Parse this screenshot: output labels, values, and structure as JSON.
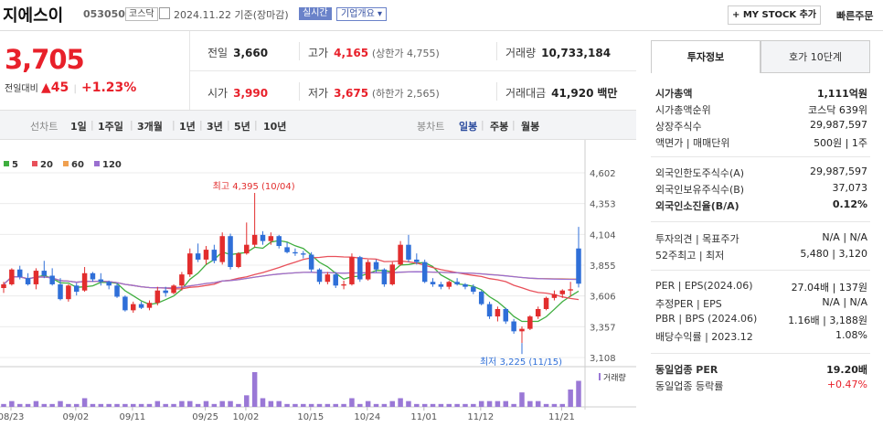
{
  "header": {
    "name": "지에스이",
    "code": "053050",
    "market": "코스닥",
    "date": "2024.11.22 기준(장마감)",
    "realtime_label": "실시간",
    "company_label": "기업개요",
    "mystock_label": "+ MY STOCK 추가",
    "quick_order": "빠른주문"
  },
  "price": {
    "current": "3,705",
    "change_label": "전일대비",
    "change_value": "▲45",
    "change_pct": "+1.23%"
  },
  "stats": {
    "prev_label": "전일",
    "prev": "3,660",
    "high_label": "고가",
    "high": "4,165",
    "high_sub": "(상한가 4,755)",
    "volume_label": "거래량",
    "volume": "10,733,184",
    "open_label": "시가",
    "open": "3,990",
    "low_label": "저가",
    "low": "3,675",
    "low_sub": "(하한가 2,565)",
    "amount_label": "거래대금",
    "amount": "41,920",
    "amount_unit": "백만"
  },
  "tabs": {
    "line_label": "선차트",
    "ranges": [
      "1일",
      "1주일",
      "3개월",
      "1년",
      "3년",
      "5년",
      "10년"
    ],
    "candle_label": "봉차트",
    "periods": [
      "일봉",
      "주봉",
      "월봉"
    ]
  },
  "chart_data": {
    "type": "candlestick",
    "legend": [
      {
        "name": "5",
        "color": "#3fae3f"
      },
      {
        "name": "20",
        "color": "#e8505a"
      },
      {
        "name": "60",
        "color": "#f0a050"
      },
      {
        "name": "120",
        "color": "#9a6fd0"
      }
    ],
    "y_ticks": [
      "4,602",
      "4,353",
      "4,104",
      "3,855",
      "3,606",
      "3,357",
      "3,108"
    ],
    "ylim": [
      3108,
      4602
    ],
    "x_ticks": [
      "08/23",
      "09/02",
      "09/11",
      "09/25",
      "10/02",
      "10/15",
      "10/24",
      "11/01",
      "11/12",
      "11/21"
    ],
    "annotation_high": "최고 4,395 (10/04)",
    "annotation_low": "최저 3,225 (11/15)",
    "volume_label": "거래량",
    "candles": [
      [
        3670,
        3720,
        3630,
        3700
      ],
      [
        3700,
        3830,
        3690,
        3820
      ],
      [
        3820,
        3850,
        3740,
        3760
      ],
      [
        3750,
        3790,
        3690,
        3700
      ],
      [
        3700,
        3830,
        3660,
        3810
      ],
      [
        3810,
        3890,
        3750,
        3770
      ],
      [
        3770,
        3830,
        3690,
        3700
      ],
      [
        3700,
        3750,
        3570,
        3580
      ],
      [
        3580,
        3700,
        3560,
        3690
      ],
      [
        3690,
        3710,
        3610,
        3640
      ],
      [
        3650,
        3840,
        3640,
        3790
      ],
      [
        3790,
        3800,
        3720,
        3740
      ],
      [
        3740,
        3790,
        3690,
        3720
      ],
      [
        3720,
        3730,
        3660,
        3690
      ],
      [
        3690,
        3710,
        3590,
        3600
      ],
      [
        3600,
        3610,
        3480,
        3490
      ],
      [
        3490,
        3560,
        3470,
        3540
      ],
      [
        3540,
        3560,
        3500,
        3510
      ],
      [
        3510,
        3570,
        3490,
        3550
      ],
      [
        3550,
        3680,
        3530,
        3650
      ],
      [
        3650,
        3680,
        3600,
        3630
      ],
      [
        3630,
        3700,
        3620,
        3690
      ],
      [
        3690,
        3800,
        3650,
        3780
      ],
      [
        3780,
        3990,
        3760,
        3950
      ],
      [
        3950,
        4030,
        3880,
        3900
      ],
      [
        3900,
        4010,
        3860,
        3980
      ],
      [
        3980,
        4020,
        3870,
        3890
      ],
      [
        3880,
        4120,
        3860,
        4090
      ],
      [
        4090,
        4110,
        3820,
        3840
      ],
      [
        3840,
        3960,
        3830,
        3950
      ],
      [
        3950,
        4200,
        3940,
        4020
      ],
      [
        4020,
        4395,
        4000,
        4100
      ],
      [
        4100,
        4130,
        4020,
        4050
      ],
      [
        4050,
        4120,
        4020,
        4090
      ],
      [
        4090,
        4100,
        3990,
        4010
      ],
      [
        4000,
        4040,
        3950,
        3960
      ],
      [
        3960,
        3990,
        3930,
        3950
      ],
      [
        3950,
        3970,
        3910,
        3940
      ],
      [
        3940,
        3960,
        3800,
        3820
      ],
      [
        3820,
        3830,
        3700,
        3720
      ],
      [
        3720,
        3800,
        3700,
        3780
      ],
      [
        3780,
        3800,
        3670,
        3690
      ],
      [
        3690,
        3730,
        3660,
        3700
      ],
      [
        3700,
        3950,
        3690,
        3920
      ],
      [
        3920,
        3930,
        3720,
        3740
      ],
      [
        3740,
        3900,
        3730,
        3880
      ],
      [
        3880,
        3900,
        3800,
        3820
      ],
      [
        3820,
        3830,
        3680,
        3700
      ],
      [
        3700,
        3880,
        3690,
        3860
      ],
      [
        3860,
        4050,
        3850,
        4020
      ],
      [
        4020,
        4100,
        3880,
        3900
      ],
      [
        3900,
        3950,
        3860,
        3880
      ],
      [
        3880,
        3900,
        3710,
        3720
      ],
      [
        3720,
        3750,
        3680,
        3700
      ],
      [
        3700,
        3720,
        3660,
        3680
      ],
      [
        3680,
        3730,
        3660,
        3720
      ],
      [
        3720,
        3750,
        3690,
        3700
      ],
      [
        3700,
        3710,
        3660,
        3680
      ],
      [
        3680,
        3700,
        3620,
        3640
      ],
      [
        3640,
        3650,
        3530,
        3540
      ],
      [
        3540,
        3560,
        3420,
        3440
      ],
      [
        3440,
        3520,
        3400,
        3500
      ],
      [
        3500,
        3510,
        3380,
        3400
      ],
      [
        3400,
        3420,
        3300,
        3320
      ],
      [
        3320,
        3360,
        3225,
        3340
      ],
      [
        3340,
        3450,
        3330,
        3440
      ],
      [
        3440,
        3520,
        3420,
        3500
      ],
      [
        3500,
        3600,
        3490,
        3590
      ],
      [
        3590,
        3650,
        3570,
        3620
      ],
      [
        3620,
        3660,
        3590,
        3650
      ],
      [
        3650,
        3720,
        3600,
        3660
      ],
      [
        3990,
        4165,
        3675,
        3705
      ]
    ],
    "volumes": [
      1,
      2,
      1,
      1,
      2,
      1,
      1,
      2,
      1,
      1,
      3,
      1,
      1,
      1,
      1,
      1,
      1,
      1,
      1,
      2,
      1,
      1,
      2,
      2,
      1,
      2,
      1,
      2,
      2,
      1,
      4,
      12,
      3,
      2,
      2,
      1,
      1,
      1,
      1,
      1,
      1,
      1,
      1,
      3,
      1,
      2,
      1,
      1,
      2,
      3,
      2,
      1,
      1,
      1,
      1,
      1,
      1,
      1,
      1,
      2,
      2,
      2,
      2,
      1,
      5,
      2,
      2,
      1,
      1,
      1,
      6,
      9
    ]
  },
  "side": {
    "tab_invest": "투자정보",
    "tab_hoga": "호가 10단계",
    "rows1": [
      {
        "k": "시가총액",
        "v": "1,111억원",
        "b": true
      },
      {
        "k": "시가총액순위",
        "v": "코스닥 639위"
      },
      {
        "k": "상장주식수",
        "v": "29,987,597"
      },
      {
        "k": "액면가 | 매매단위",
        "v": "500원 | 1주"
      }
    ],
    "rows2": [
      {
        "k": "외국인한도주식수(A)",
        "v": "29,987,597"
      },
      {
        "k": "외국인보유주식수(B)",
        "v": "37,073"
      },
      {
        "k": "외국인소진율(B/A)",
        "v": "0.12%",
        "b": true
      }
    ],
    "rows3": [
      {
        "k": "투자의견 | 목표주가",
        "v": "N/A | N/A"
      },
      {
        "k": "52주최고 | 최저",
        "v": "5,480 | 3,120"
      }
    ],
    "rows4": [
      {
        "k": "PER | EPS(2024.06)",
        "v": "27.04배 | 137원"
      },
      {
        "k": "추정PER | EPS",
        "v": "N/A | N/A"
      },
      {
        "k": "PBR | BPS (2024.06)",
        "v": "1.16배 | 3,188원"
      },
      {
        "k": "배당수익률 | 2023.12",
        "v": "1.08%"
      }
    ],
    "rows5": [
      {
        "k": "동일업종 PER",
        "v": "19.20배",
        "b": true
      },
      {
        "k": "동일업종 등락률",
        "v": "+0.47%",
        "up": true
      }
    ]
  }
}
